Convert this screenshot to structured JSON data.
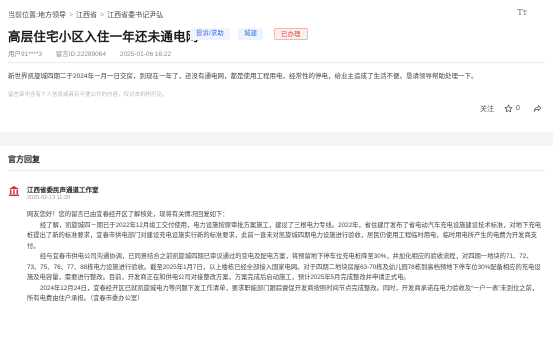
{
  "breadcrumb": {
    "prefix": "当前位置:",
    "items": [
      "地方领导",
      "江西省",
      "江西省委书记尹弘"
    ]
  },
  "font_button": "Tт",
  "message": {
    "title": "高层住宅小区入住一年还未通电网",
    "tags": [
      "投诉/求助",
      "城建",
      "已办理"
    ],
    "author": "用户91****3",
    "message_id": "留言ID:22289064",
    "date": "2025-01-06 16:22",
    "content": "新世界凯旋城四期二于2024年一月一日交房，到现在一年了，还没有通电网，都是使用工程用电，经常性的停电，给业主造成了生活不便。恳请领导帮助处理一下。",
    "disclaimer": "留言审中含有个人信息或具有不便公开的内容，仅对本机构可见。"
  },
  "actions": {
    "follow": "关注",
    "like_count": "0"
  },
  "reply_section": {
    "title": "官方回复",
    "org_name": "江西省委民声通道工作室",
    "date": "2025-02-13 11:39",
    "paragraphs": [
      "网友您好！您的留言已由宜春经开区了解核处，现将有关情况回复如下：",
      "经了解，凯旋城四－期已于2022年12月竣工交付使用，电力设施按原审批方案施工，建设了三根电力专线。2022年，省住建厅发布了省电动汽车充电设施建设技术标准，对地下充电桩提出了新的标准要求，宜春市供电部门对建设充电设施实行新的标准要求，此前一直未对凯旋城四期电力设施进行验收，居民仍使用工程临时用电，临时用电所产生的电费为开发商支付。",
      "经与宜春市供电公司沟通协调，已同意结合之前凯旋城四期已审议通过的变电及配电方案，将预留地下停车位充电桩降至30%，并加化相应的验收流程，对四期一地块的71、72、73、75、76、77、88栋电力设施进行验收。截至2025年1月7日，以上楼栋已经全部接入国家电网。对于四期二地块房屋63-70栋及幼儿园78栋到高档预地下停车位30%配备相应的充电设施及电容量，需要进行整改。目前，开发商正在和供电公司对接整改方案，方案完成后启动施工，预计2025年5月完成整改并申请正式电。",
      "2024年12月24日，宜春经开区已就凯旋城电力等问题下发工作清单，要求职能部门跟踪督促开发商按照时间节点完成整改。同时，开发商承诺在电力验收及“一户一表”未到位之前，所有电费由住户承担。（宜春市委办公室）"
    ]
  }
}
